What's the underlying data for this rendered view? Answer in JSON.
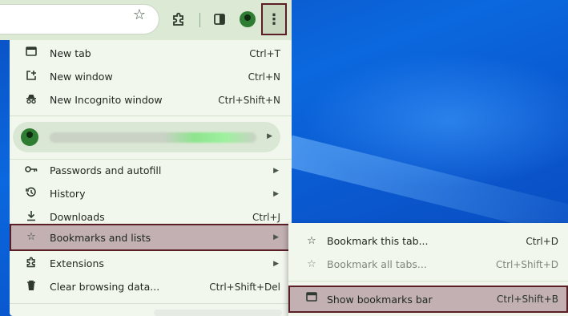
{
  "menu": {
    "items_top": [
      {
        "icon": "tab-icon",
        "label": "New tab",
        "shortcut": "Ctrl+T"
      },
      {
        "icon": "new-window-icon",
        "label": "New window",
        "shortcut": "Ctrl+N"
      },
      {
        "icon": "incognito-icon",
        "label": "New Incognito window",
        "shortcut": "Ctrl+Shift+N"
      }
    ],
    "items_mid": [
      {
        "icon": "key-icon",
        "label": "Passwords and autofill",
        "shortcut": ""
      },
      {
        "icon": "history-icon",
        "label": "History",
        "shortcut": ""
      },
      {
        "icon": "download-icon",
        "label": "Downloads",
        "shortcut": "Ctrl+J"
      },
      {
        "icon": "star-icon",
        "label": "Bookmarks and lists",
        "shortcut": ""
      },
      {
        "icon": "puzzle-icon",
        "label": "Extensions",
        "shortcut": ""
      },
      {
        "icon": "trash-icon",
        "label": "Clear browsing data...",
        "shortcut": "Ctrl+Shift+Del"
      }
    ]
  },
  "submenu": {
    "items": [
      {
        "icon": "star-icon",
        "label": "Bookmark this tab...",
        "shortcut": "Ctrl+D"
      },
      {
        "icon": "star-outline-icon",
        "label": "Bookmark all tabs...",
        "shortcut": "Ctrl+Shift+D"
      },
      {
        "icon": "bookmarks-bar-icon",
        "label": "Show bookmarks bar",
        "shortcut": "Ctrl+Shift+B"
      }
    ]
  },
  "colors": {
    "menu_bg": "#f2f7ee",
    "highlight": "#c2b0b3",
    "highlight_border": "#5b1e24",
    "desktop": "#0a63d0"
  }
}
